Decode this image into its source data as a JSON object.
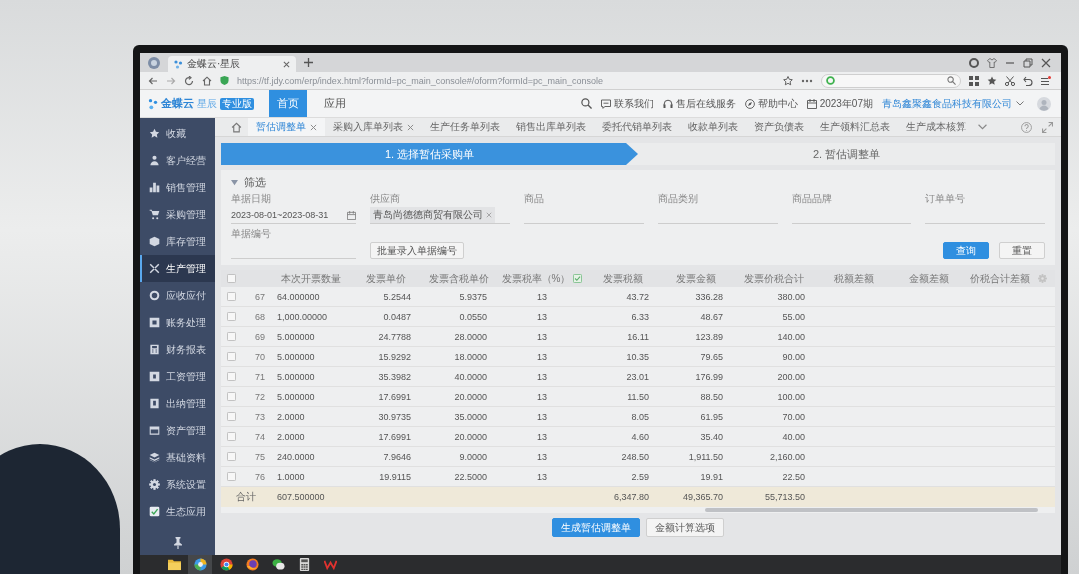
{
  "browser": {
    "tab_title": "金蝶云·星辰",
    "url": "https://tf.jdy.com/erp/index.html?formId=pc_main_console#/oform?formId=pc_main_console"
  },
  "header": {
    "logo": "金蝶云",
    "logo_sub": "星辰",
    "edition": "专业版",
    "nav": [
      {
        "label": "首页",
        "selected": true
      },
      {
        "label": "应用",
        "selected": false
      }
    ],
    "links": [
      "联系我们",
      "售后在线服务",
      "帮助中心"
    ],
    "period": "2023年07期",
    "company": "青岛鑫聚鑫食品科技有限公司"
  },
  "sidebar": {
    "items": [
      {
        "label": "收藏",
        "selected": false
      },
      {
        "label": "客户经营",
        "selected": false
      },
      {
        "label": "销售管理",
        "selected": false
      },
      {
        "label": "采购管理",
        "selected": false
      },
      {
        "label": "库存管理",
        "selected": false
      },
      {
        "label": "生产管理",
        "selected": true
      },
      {
        "label": "应收应付",
        "selected": false
      },
      {
        "label": "账务处理",
        "selected": false
      },
      {
        "label": "财务报表",
        "selected": false
      },
      {
        "label": "工资管理",
        "selected": false
      },
      {
        "label": "出纳管理",
        "selected": false
      },
      {
        "label": "资产管理",
        "selected": false
      },
      {
        "label": "基础资料",
        "selected": false
      },
      {
        "label": "系统设置",
        "selected": false
      },
      {
        "label": "生态应用",
        "selected": false
      }
    ]
  },
  "tabs": [
    {
      "label": "暂估调整单",
      "selected": true,
      "closable": true
    },
    {
      "label": "采购入库单列表",
      "selected": false,
      "closable": true
    },
    {
      "label": "生产任务单列表",
      "selected": false,
      "closable": false
    },
    {
      "label": "销售出库单列表",
      "selected": false,
      "closable": false
    },
    {
      "label": "委托代销单列表",
      "selected": false,
      "closable": false
    },
    {
      "label": "收款单列表",
      "selected": false,
      "closable": false
    },
    {
      "label": "资产负债表",
      "selected": false,
      "closable": false
    },
    {
      "label": "生产领料汇总表",
      "selected": false,
      "closable": false
    },
    {
      "label": "生产成本核算",
      "selected": false,
      "closable": false
    }
  ],
  "steps": [
    {
      "label": "1. 选择暂估采购单",
      "selected": true
    },
    {
      "label": "2. 暂估调整单",
      "selected": false
    }
  ],
  "filter": {
    "title": "筛选",
    "expanded": true,
    "fields": [
      {
        "label": "单据日期",
        "kind": "date",
        "value": "2023-08-01~2023-08-31"
      },
      {
        "label": "供应商",
        "kind": "tag",
        "value": "青岛尚德德商贸有限公司"
      },
      {
        "label": "商品",
        "kind": "text"
      },
      {
        "label": "商品类别",
        "kind": "text"
      },
      {
        "label": "商品品牌",
        "kind": "text"
      },
      {
        "label": "订单单号",
        "kind": "text"
      },
      {
        "label": "单据编号",
        "kind": "text"
      }
    ],
    "batch_button": "批量录入单据编号",
    "buttons": [
      {
        "label": "查询",
        "kind": "primary"
      },
      {
        "label": "重置",
        "kind": "default"
      }
    ]
  },
  "table": {
    "all_checked": false,
    "columns": [
      "本次开票数量",
      "发票单价",
      "发票含税单价",
      "发票税率（%）",
      "发票税额",
      "发票金额",
      "发票价税合计",
      "税额差额",
      "金额差额",
      "价税合计差额"
    ],
    "rows": [
      {
        "index": "67",
        "checked": false,
        "cells": [
          "64.000000",
          "5.2544",
          "5.9375",
          "13",
          "43.72",
          "336.28",
          "380.00"
        ]
      },
      {
        "index": "68",
        "checked": false,
        "cells": [
          "1,000.00000",
          "0.0487",
          "0.0550",
          "13",
          "6.33",
          "48.67",
          "55.00"
        ]
      },
      {
        "index": "69",
        "checked": false,
        "cells": [
          "5.000000",
          "24.7788",
          "28.0000",
          "13",
          "16.11",
          "123.89",
          "140.00"
        ]
      },
      {
        "index": "70",
        "checked": false,
        "cells": [
          "5.000000",
          "15.9292",
          "18.0000",
          "13",
          "10.35",
          "79.65",
          "90.00"
        ]
      },
      {
        "index": "71",
        "checked": false,
        "cells": [
          "5.000000",
          "35.3982",
          "40.0000",
          "13",
          "23.01",
          "176.99",
          "200.00"
        ]
      },
      {
        "index": "72",
        "checked": false,
        "cells": [
          "5.000000",
          "17.6991",
          "20.0000",
          "13",
          "11.50",
          "88.50",
          "100.00"
        ]
      },
      {
        "index": "73",
        "checked": false,
        "cells": [
          "2.0000",
          "30.9735",
          "35.0000",
          "13",
          "8.05",
          "61.95",
          "70.00"
        ]
      },
      {
        "index": "74",
        "checked": false,
        "cells": [
          "2.0000",
          "17.6991",
          "20.0000",
          "13",
          "4.60",
          "35.40",
          "40.00"
        ]
      },
      {
        "index": "75",
        "checked": false,
        "cells": [
          "240.0000",
          "7.9646",
          "9.0000",
          "13",
          "248.50",
          "1,911.50",
          "2,160.00"
        ]
      },
      {
        "index": "76",
        "checked": false,
        "cells": [
          "1.0000",
          "19.9115",
          "22.5000",
          "13",
          "2.59",
          "19.91",
          "22.50"
        ]
      }
    ],
    "total": {
      "label": "合计",
      "quantity": "607.500000",
      "tax": "6,347.80",
      "amount": "49,365.70",
      "amount_with_tax": "55,713.50"
    }
  },
  "actions": [
    {
      "label": "生成暂估调整单",
      "kind": "primary"
    },
    {
      "label": "金额计算选项",
      "kind": "default"
    }
  ]
}
